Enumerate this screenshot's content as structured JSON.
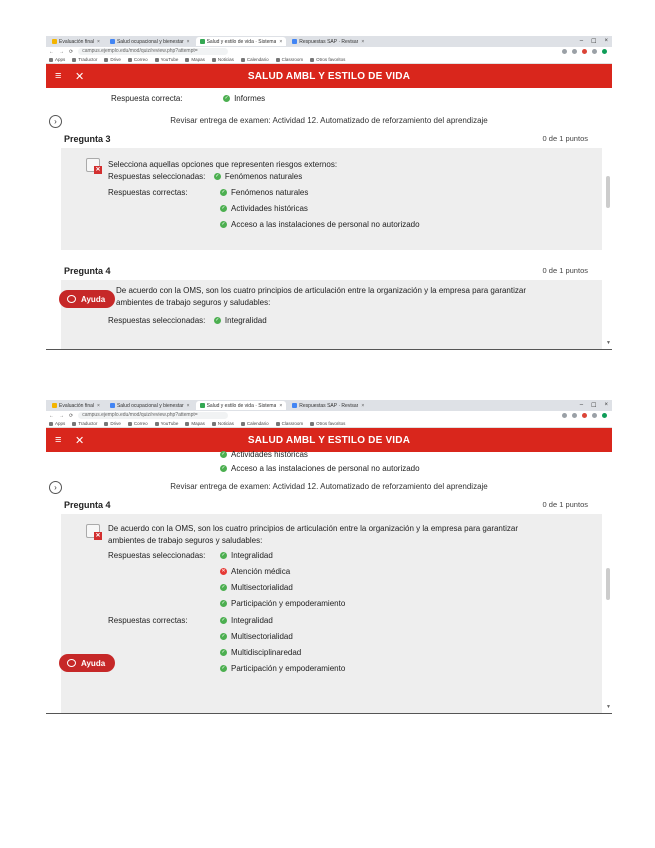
{
  "browser": {
    "tabs": [
      "Evaluación final",
      "Salud ocupacional y bienestar",
      "Salud y estilo de vida · Sistema",
      "Respuestas SAP · Revisar"
    ],
    "tab_close": "×",
    "window_controls": [
      "–",
      "☐",
      "×"
    ],
    "url": "campus.ejemplo.edu/mod/quiz/review.php?attempt=",
    "bookmarks": [
      "Apps",
      "Traductor",
      "Drive",
      "Correo",
      "YouTube",
      "Mapas",
      "Noticias",
      "Calendario",
      "Classroom",
      "Otros favoritos"
    ]
  },
  "header": {
    "title": "SALUD AMBL Y ESTILO DE VIDA",
    "menu_icon": "≡",
    "close_icon": "✕"
  },
  "review_link": "Revisar entrega de examen: Actividad 12. Automatizado de reforzamiento del aprendizaje",
  "help_label": "Ayuda",
  "screen1": {
    "prev_answer_label": "Respuesta correcta:",
    "prev_answer_value": "Informes",
    "question3": {
      "title": "Pregunta 3",
      "points": "0 de 1 puntos",
      "prompt": "Selecciona aquellas opciones que representen riesgos externos:",
      "selected_label": "Respuestas seleccionadas:",
      "selected": [
        "Fenómenos naturales"
      ],
      "correct_label": "Respuestas correctas:",
      "correct": [
        "Fenómenos naturales",
        "Actividades históricas",
        "Acceso a las instalaciones de personal no autorizado"
      ]
    },
    "question4": {
      "title": "Pregunta 4",
      "points": "0 de 1 puntos",
      "prompt_line1": "De acuerdo con la OMS, son los cuatro principios de articulación entre la organización y la empresa para garantizar",
      "prompt_line2": "ambientes de trabajo seguros y saludables:",
      "selected_label": "Respuestas seleccionadas:",
      "selected_first": "Integralidad"
    }
  },
  "screen2": {
    "top_items": [
      "Actividades históricas",
      "Acceso a las instalaciones de personal no autorizado"
    ],
    "question4": {
      "title": "Pregunta 4",
      "points": "0 de 1 puntos",
      "prompt_line1": "De acuerdo con la OMS, son los cuatro principios de articulación entre la organización y la empresa para garantizar",
      "prompt_line2": "ambientes de trabajo seguros y saludables:",
      "selected_label": "Respuestas seleccionadas:",
      "selected": [
        {
          "text": "Integralidad",
          "correct": true
        },
        {
          "text": "Atención médica",
          "correct": false
        },
        {
          "text": "Multisectorialidad",
          "correct": true
        },
        {
          "text": "Participación y empoderamiento",
          "correct": true
        }
      ],
      "correct_label": "Respuestas correctas:",
      "correct": [
        "Integralidad",
        "Multisectorialidad",
        "Multidisciplinaredad",
        "Participación y empoderamiento"
      ]
    }
  },
  "colors": {
    "header_red": "#d9261c",
    "check_green": "#4caf50",
    "cross_red": "#e53935",
    "grey_box": "#eeeeee"
  }
}
